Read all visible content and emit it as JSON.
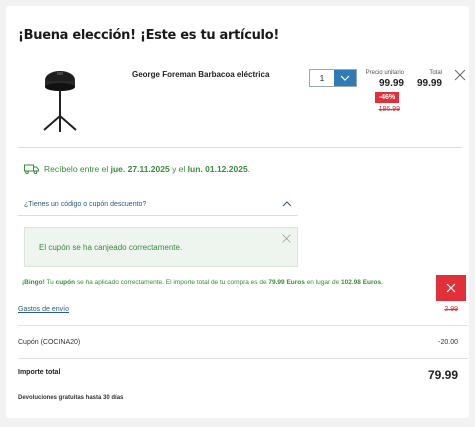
{
  "header": {
    "title": "¡Buena elección! ¡Este es tu artículo!"
  },
  "item": {
    "image_icon": "grill-product-image",
    "name": "George Foreman Barbacoa eléctrica",
    "quantity": "1",
    "unit_price_label": "Precio unitario",
    "unit_price": "99.99",
    "discount": "-46%",
    "old_price": "186.99",
    "total_label": "Total",
    "total_price": "99.99",
    "remove_icon": "close-icon"
  },
  "delivery": {
    "icon": "truck-icon",
    "prefix": "Recíbelo entre el ",
    "start": "jue. 27.11.2025",
    "middle": " y el ",
    "end": "lun. 01.12.2025",
    "suffix": "."
  },
  "coupon": {
    "toggle_label": "¿Tienes un código o cupón descuento?",
    "success_message": "El cupón se ha canjeado correctamente.",
    "bingo_strong": "¡Bingo!",
    "bingo_1": " Tu ",
    "bingo_coupon": "cupón",
    "bingo_2": " se ha aplicado correctamente. El importe total de tu compra es de ",
    "bingo_amount": "79.99 Euros",
    "bingo_3": " en lugar de ",
    "bingo_original": "102.98 Euros",
    "bingo_4": "."
  },
  "summary": {
    "shipping_label": "Gastos de envío",
    "shipping_value": "2.99",
    "coupon_label": "Cupón (COCINA20)",
    "coupon_value": "-20.00",
    "total_label": "Importe total",
    "total_value": "79.99",
    "returns_note": "Devoluciones gratuitas hasta 30 días"
  },
  "colors": {
    "accent_blue": "#2f7bb8",
    "discount_red": "#e1303a",
    "success_green": "#3a8a3e"
  }
}
